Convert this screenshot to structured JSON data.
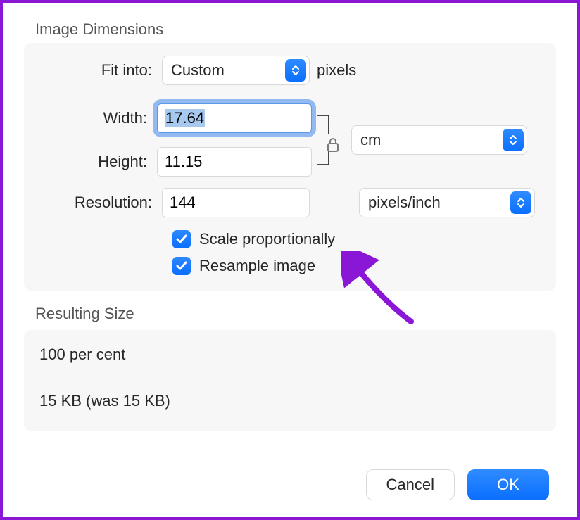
{
  "section_dimensions_title": "Image Dimensions",
  "fit_into": {
    "label": "Fit into:",
    "value": "Custom",
    "unit": "pixels"
  },
  "width": {
    "label": "Width:",
    "value": "17.64"
  },
  "height": {
    "label": "Height:",
    "value": "11.15"
  },
  "wh_unit": "cm",
  "resolution": {
    "label": "Resolution:",
    "value": "144",
    "unit": "pixels/inch"
  },
  "scale_proportionally": {
    "label": "Scale proportionally",
    "checked": true
  },
  "resample_image": {
    "label": "Resample image",
    "checked": true
  },
  "section_result_title": "Resulting Size",
  "result_percent": "100 per cent",
  "result_size": "15 KB (was 15 KB)",
  "buttons": {
    "cancel": "Cancel",
    "ok": "OK"
  }
}
